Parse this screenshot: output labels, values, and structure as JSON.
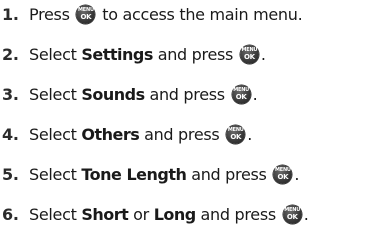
{
  "icon": {
    "name": "menu-ok-icon",
    "top_label": "MENU",
    "bottom_label": "OK",
    "color": "#333333"
  },
  "steps": [
    {
      "number": "1.",
      "text_a": "Press",
      "text_b": "to access the main menu."
    },
    {
      "number": "2.",
      "text_a": "Select",
      "bold": "Settings",
      "text_b": "and press",
      "end": "."
    },
    {
      "number": "3.",
      "text_a": "Select",
      "bold": "Sounds",
      "text_b": "and press",
      "end": "."
    },
    {
      "number": "4.",
      "text_a": "Select",
      "bold": "Others",
      "text_b": "and press",
      "end": "."
    },
    {
      "number": "5.",
      "text_a": "Select",
      "bold": "Tone Length",
      "text_b": "and press",
      "end": "."
    },
    {
      "number": "6.",
      "text_a": "Select",
      "bold": "Short",
      "text_c": "or",
      "bold2": "Long",
      "text_b": "and press",
      "end": "."
    }
  ]
}
